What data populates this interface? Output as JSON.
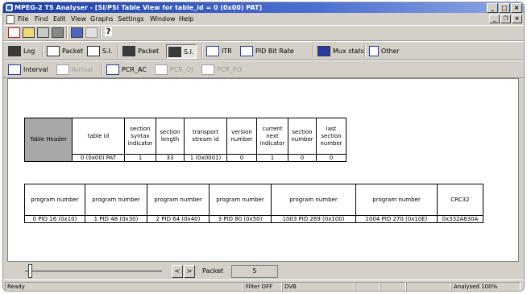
{
  "window": {
    "title": "MPEG-2 TS Analyser - [SI/PSI Table View for table_id = 0 (0x00) PAT]"
  },
  "menu": [
    "File",
    "Find",
    "Edit",
    "View",
    "Graphs",
    "Settings",
    "Window",
    "Help"
  ],
  "toolbar_views": [
    {
      "label": "Log",
      "icon": "log-icon"
    },
    {
      "label": "Packet",
      "icon": "packet-icon"
    },
    {
      "label": "S.I.",
      "icon": "si-icon"
    },
    {
      "label": "Packet",
      "icon": "packet-view-icon"
    },
    {
      "label": "S.I.",
      "icon": "si-view-icon"
    },
    {
      "label": "ITR",
      "icon": "itr-icon"
    },
    {
      "label": "PID Bit Rate",
      "icon": "pid-bitrate-icon"
    },
    {
      "label": "Mux stats",
      "icon": "mux-stats-icon"
    },
    {
      "label": "Other",
      "icon": "other-icon"
    }
  ],
  "toolbar_graphs": [
    {
      "label": "Interval",
      "enabled": true
    },
    {
      "label": "Arrival",
      "enabled": false
    },
    {
      "label": "PCR_AC",
      "enabled": true
    },
    {
      "label": "PCR_OJ",
      "enabled": false
    },
    {
      "label": "PCR_FO",
      "enabled": false
    }
  ],
  "table_header": {
    "row_label": "Table Header",
    "columns": [
      "table id",
      "section syntax indicator",
      "section length",
      "transport stream id",
      "version number",
      "current next indicator",
      "section number",
      "last section number"
    ],
    "values": [
      "0 (0x00) PAT",
      "1",
      "33",
      "1 (0x0001)",
      "0",
      "1",
      "0",
      "0"
    ]
  },
  "program_table": {
    "columns": [
      "program number",
      "program number",
      "program number",
      "program number",
      "program number",
      "program number",
      "CRC32"
    ],
    "values": [
      "0 PID 16 (0x10)",
      "1 PID 48 (0x30)",
      "2 PID 64 (0x40)",
      "3 PID 80 (0x50)",
      "1003 PID 269 (0x100)",
      "1004 PID 270 (0x10E)",
      "0x332A830A"
    ]
  },
  "nav": {
    "prev": "<",
    "next": ">",
    "packet_label": "Packet",
    "packet_value": "5"
  },
  "status": {
    "ready": "Ready",
    "filter": "Filter OFF",
    "mode": "DVB",
    "analysed": "Analysed 100%"
  }
}
